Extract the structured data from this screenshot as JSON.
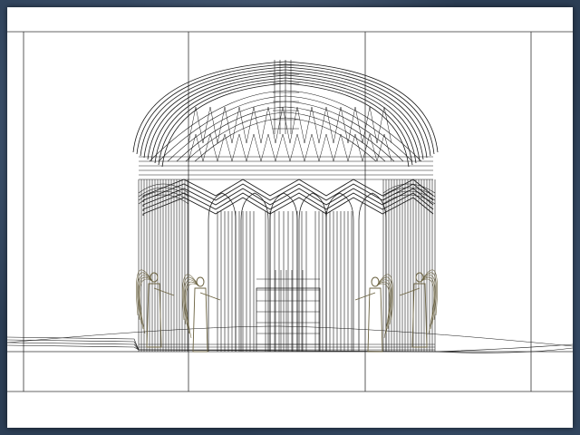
{
  "viewport": {
    "background": "#ffffff",
    "line_color": "#1a1a1a",
    "figure_tint": "#6b6240"
  }
}
